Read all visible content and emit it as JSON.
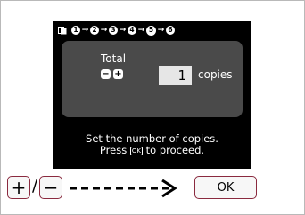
{
  "screen": {
    "steps": [
      {
        "label": "1",
        "active": false
      },
      {
        "label": "2",
        "active": false
      },
      {
        "label": "3",
        "active": false
      },
      {
        "label": "4",
        "active": false
      },
      {
        "label": "5",
        "active": true
      },
      {
        "label": "6",
        "active": false
      }
    ],
    "total_label": "Total",
    "minus_glyph": "−",
    "plus_glyph": "+",
    "quantity": "1",
    "copies_label": "copies",
    "message_line1": "Set the number of copies.",
    "message_line2_prefix": "Press",
    "message_ok_key": "OK",
    "message_line2_suffix": "to proceed."
  },
  "controls": {
    "plus_key": "+",
    "separator": "/",
    "minus_key": "−",
    "ok_key": "OK"
  },
  "colors": {
    "lcd_background": "#000000",
    "panel_background": "#4a4a4a",
    "key_border": "#8a2a3f"
  }
}
